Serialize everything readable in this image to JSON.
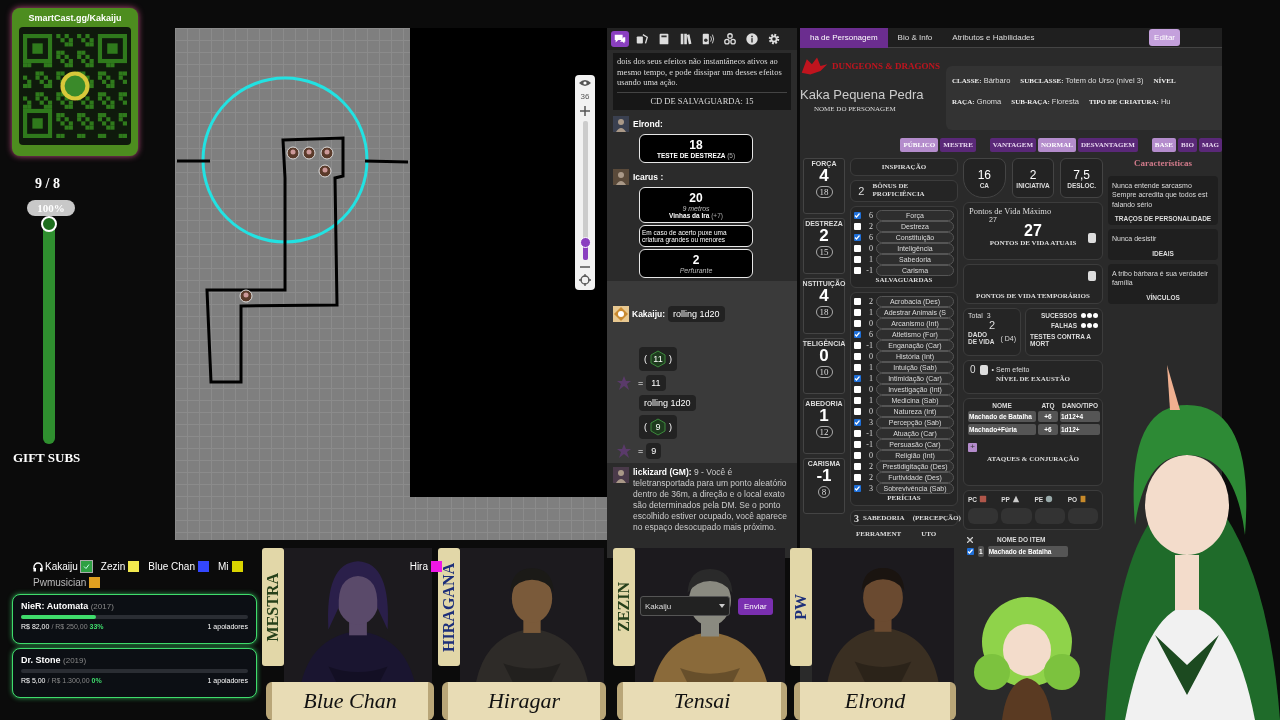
{
  "qr_card": {
    "url": "SmartCast.gg/Kakaiju"
  },
  "sub_goal": {
    "count": "9 / 8",
    "percent": "100%",
    "level": 1,
    "label": "GIFT SUBS"
  },
  "map": {
    "zoom": {
      "reading": "36",
      "level": 0.12
    }
  },
  "chat": {
    "tabs": [
      {
        "kind": "chat",
        "selected": true
      },
      {
        "kind": "dice",
        "selected": false
      },
      {
        "kind": "journal",
        "selected": false
      },
      {
        "kind": "compendium",
        "selected": false
      },
      {
        "kind": "jukebox",
        "selected": false
      },
      {
        "kind": "collections",
        "selected": false
      },
      {
        "kind": "info",
        "selected": false
      },
      {
        "kind": "settings",
        "selected": false
      }
    ],
    "messages": [
      {
        "kind": "template",
        "text": "dois dos seus efeitos não instantâneos ativos ao mesmo tempo, e pode dissipar um desses efeitos usando uma ação.",
        "footer": "CD DE SALVAGUARDA: 15"
      },
      {
        "kind": "check",
        "speaker": "Elrond:",
        "total": "18",
        "label": "TESTE DE DESTREZA",
        "mod": "(5)"
      },
      {
        "kind": "attack",
        "speaker": "Icarus :",
        "total": "20",
        "range": "9 metros",
        "label": "Vinhas da Ira",
        "mod": "(+7)",
        "description": "Em caso de acerto puxe uma criatura grandes ou menores",
        "damage": "2",
        "damage_type": "Perfurante"
      },
      {
        "kind": "dice",
        "speaker": "Kakaiju:",
        "rolls": [
          {
            "command": "rolling 1d20",
            "open": "(",
            "die": "11",
            "close": ")",
            "equals": "=",
            "result": "11"
          },
          {
            "command": "rolling 1d20",
            "open": "(",
            "die": "9",
            "close": ")",
            "equals": "=",
            "result": "9"
          }
        ]
      },
      {
        "kind": "gm",
        "speaker": "lickizard (GM):",
        "text": "9 - Você é teletransportada para um ponto aleatório dentro de 36m, a direção e o local exato são determinados pela DM. Se o ponto escolhido estiver ocupado, você aparece no espaço desocupado mais próximo."
      }
    ],
    "input": {
      "value": "Kakaiju"
    },
    "send_button": "Enviar"
  },
  "sheet": {
    "tabs": [
      {
        "label": "ha de Personagem",
        "selected": true
      },
      {
        "label": "Bio & Info",
        "selected": false
      },
      {
        "label": "Atributos e Habilidades",
        "selected": false
      }
    ],
    "edit_button": "Editar",
    "logo": "DUNGEONS & DRAGONS",
    "character_name": "Kaka Pequena Pedra",
    "name_label": "NOME DO PERSONAGEM",
    "info": [
      {
        "label": "CLASSE:",
        "value": "Bárbaro"
      },
      {
        "label": "SUBCLASSE:",
        "value": "Totem do Urso (nível 3)"
      },
      {
        "label": "NÍVEL"
      },
      {
        "label": "RAÇA:",
        "value": "Gnoma"
      },
      {
        "label": "SUB-RAÇA:",
        "value": "Floresta"
      },
      {
        "label": "TIPO DE CRIATURA:",
        "value": "Hu"
      }
    ],
    "toggle_groups": [
      {
        "items": [
          {
            "label": "PÚBLICO",
            "selected": true
          },
          {
            "label": "MESTRE",
            "selected": false
          }
        ]
      },
      {
        "items": [
          {
            "label": "VANTAGEM",
            "selected": false
          },
          {
            "label": "NORMAL",
            "selected": true
          },
          {
            "label": "DESVANTAGEM",
            "selected": false
          }
        ]
      },
      {
        "items": [
          {
            "label": "BASE",
            "selected": true
          },
          {
            "label": "BIO",
            "selected": false
          },
          {
            "label": "MAG",
            "selected": false
          }
        ]
      }
    ],
    "abilities": [
      {
        "label": "FORÇA",
        "modifier": "4",
        "score": "18"
      },
      {
        "label": "DESTREZA",
        "modifier": "2",
        "score": "15"
      },
      {
        "label": "NSTITUIÇÃO",
        "modifier": "4",
        "score": "18"
      },
      {
        "label": "TELIGÊNCIA",
        "modifier": "0",
        "score": "10"
      },
      {
        "label": "ABEDORIA",
        "modifier": "1",
        "score": "12"
      },
      {
        "label": "CARISMA",
        "modifier": "-1",
        "score": "8"
      }
    ],
    "inspiration_label": "INSPIRAÇÃO",
    "proficiency": {
      "value": "2",
      "label": "BÔNUS DE PROFICIÊNCIA"
    },
    "saves": {
      "title": "SALVAGUARDAS",
      "items": [
        {
          "value": "6",
          "name": "Força",
          "checked": true
        },
        {
          "value": "2",
          "name": "Destreza",
          "checked": false
        },
        {
          "value": "6",
          "name": "Constituição",
          "checked": true
        },
        {
          "value": "0",
          "name": "Inteligência",
          "checked": false
        },
        {
          "value": "1",
          "name": "Sabedoria",
          "checked": false
        },
        {
          "value": "-1",
          "name": "Carisma",
          "checked": false
        }
      ]
    },
    "skills": {
      "title": "PERÍCIAS",
      "items": [
        {
          "value": "2",
          "name": "Acrobacia (Des)",
          "checked": false
        },
        {
          "value": "1",
          "name": "Adestrar Animais (S",
          "checked": false
        },
        {
          "value": "0",
          "name": "Arcanismo (Int)",
          "checked": false
        },
        {
          "value": "6",
          "name": "Atletismo (For)",
          "checked": true
        },
        {
          "value": "-1",
          "name": "Enganação (Car)",
          "checked": false
        },
        {
          "value": "0",
          "name": "História (Int)",
          "checked": false
        },
        {
          "value": "1",
          "name": "Intuição (Sab)",
          "checked": false
        },
        {
          "value": "1",
          "name": "Intimidação (Car)",
          "checked": true
        },
        {
          "value": "0",
          "name": "Investigação (Int)",
          "checked": false
        },
        {
          "value": "1",
          "name": "Medicina (Sab)",
          "checked": false
        },
        {
          "value": "0",
          "name": "Natureza (Int)",
          "checked": false
        },
        {
          "value": "3",
          "name": "Percepção (Sab)",
          "checked": true
        },
        {
          "value": "-1",
          "name": "Atuação (Car)",
          "checked": false
        },
        {
          "value": "-1",
          "name": "Persuasão (Car)",
          "checked": false
        },
        {
          "value": "0",
          "name": "Religião (Int)",
          "checked": false
        },
        {
          "value": "2",
          "name": "Prestidigitação (Des)",
          "checked": false
        },
        {
          "value": "2",
          "name": "Furtividade (Des)",
          "checked": false
        },
        {
          "value": "3",
          "name": "Sobrevivência (Sab)",
          "checked": true
        }
      ]
    },
    "passive": {
      "value": "3",
      "parts": [
        "SABEDORIA",
        "(PERCEPÇÃO)"
      ]
    },
    "tools": {
      "parts": [
        "FERRAMENT",
        "UTO"
      ]
    },
    "stats": [
      {
        "kind": "shield",
        "value": "16",
        "label": "CA"
      },
      {
        "kind": "box",
        "value": "2",
        "label": "INICIATIVA"
      },
      {
        "kind": "box",
        "value": "7,5",
        "label": "DESLOC."
      }
    ],
    "hp": {
      "max_label": "Pontos de Vida Máximo",
      "max": "27",
      "current": "27",
      "current_label": "PONTOS DE VIDA ATUAIS",
      "temp_label": "PONTOS DE VIDA TEMPORÁRIOS"
    },
    "hit_dice": {
      "total_label": "Total",
      "total": "3",
      "value": "2",
      "label": "DADO DE VIDA",
      "die": "( D4)"
    },
    "death_saves": {
      "success_label": "SUCESSOS",
      "failure_label": "FALHAS",
      "label": "TESTES CONTRA A MORT"
    },
    "exhaustion": {
      "value": "0",
      "effect": "• Sem efeito",
      "label": "NÍVEL DE EXAUSTÃO"
    },
    "attacks": {
      "columns": [
        "NOME",
        "ATQ",
        "DANO/TIPO"
      ],
      "rows": [
        {
          "name": "Machado de Batalha",
          "bonus": "+6",
          "damage": "1d12+4"
        },
        {
          "name": "Machado+Fúria",
          "bonus": "+6",
          "damage": "1d12+"
        }
      ],
      "add": "+",
      "title": "ATAQUES & CONJURAÇÃO"
    },
    "coins": [
      {
        "kind": "copper",
        "label": "PC"
      },
      {
        "kind": "silver",
        "label": "PP"
      },
      {
        "kind": "electrum",
        "label": "PE"
      },
      {
        "kind": "gold",
        "label": "PO"
      }
    ],
    "items": {
      "header": "NOME DO ITEM",
      "rows": [
        {
          "checked": true,
          "qty": "1",
          "name": "Machado de Batalha"
        }
      ]
    },
    "characteristics": {
      "title": "Características",
      "sections": [
        {
          "text": "Nunca entende sarcasmo\nSempre acredita que todos est\nfalando sério",
          "label": "TRAÇOS DE PERSONALIDADE"
        },
        {
          "text": "Nunca desistir",
          "label": "IDEAIS"
        },
        {
          "text": "A tribo bárbara é sua verdadeir\nfamília",
          "label": "VÍNCULOS"
        }
      ]
    }
  },
  "voice": [
    {
      "kind": "self",
      "name": "Kakaiju",
      "color": "#2ea043"
    },
    {
      "kind": "member",
      "name": "Zezin",
      "color": "#f2e94e"
    },
    {
      "kind": "member",
      "name": "Blue Chan",
      "color": "#3347ff"
    },
    {
      "kind": "member",
      "name": "Mi",
      "color": "#d9d400"
    },
    {
      "kind": "member",
      "name": "Hira",
      "color": "#ee16e6"
    },
    {
      "kind": "member",
      "name": "Pwmusician",
      "color": "#e0a020"
    }
  ],
  "goals": [
    {
      "title": "NieR: Automata",
      "year": "(2017)",
      "raised": "R$ 82,00",
      "separator": "/",
      "target": "R$ 250,00",
      "percent": "33%",
      "level": 0.33,
      "supporters": "1 apoiadores"
    },
    {
      "title": "Dr. Stone",
      "year": "(2019)",
      "raised": "R$ 5,00",
      "separator": "/",
      "target": "R$ 1.300,00",
      "percent": "0%",
      "level": 0,
      "supporters": "1 apoiadores"
    }
  ],
  "portraits": [
    {
      "banner": "MESTRA",
      "name": "Blue Chan"
    },
    {
      "banner": "HIRAGANA",
      "name": "Hiragar"
    },
    {
      "banner": "ZEZIN",
      "name": "Tensai"
    },
    {
      "banner": "PW",
      "name": "Elrond"
    }
  ]
}
